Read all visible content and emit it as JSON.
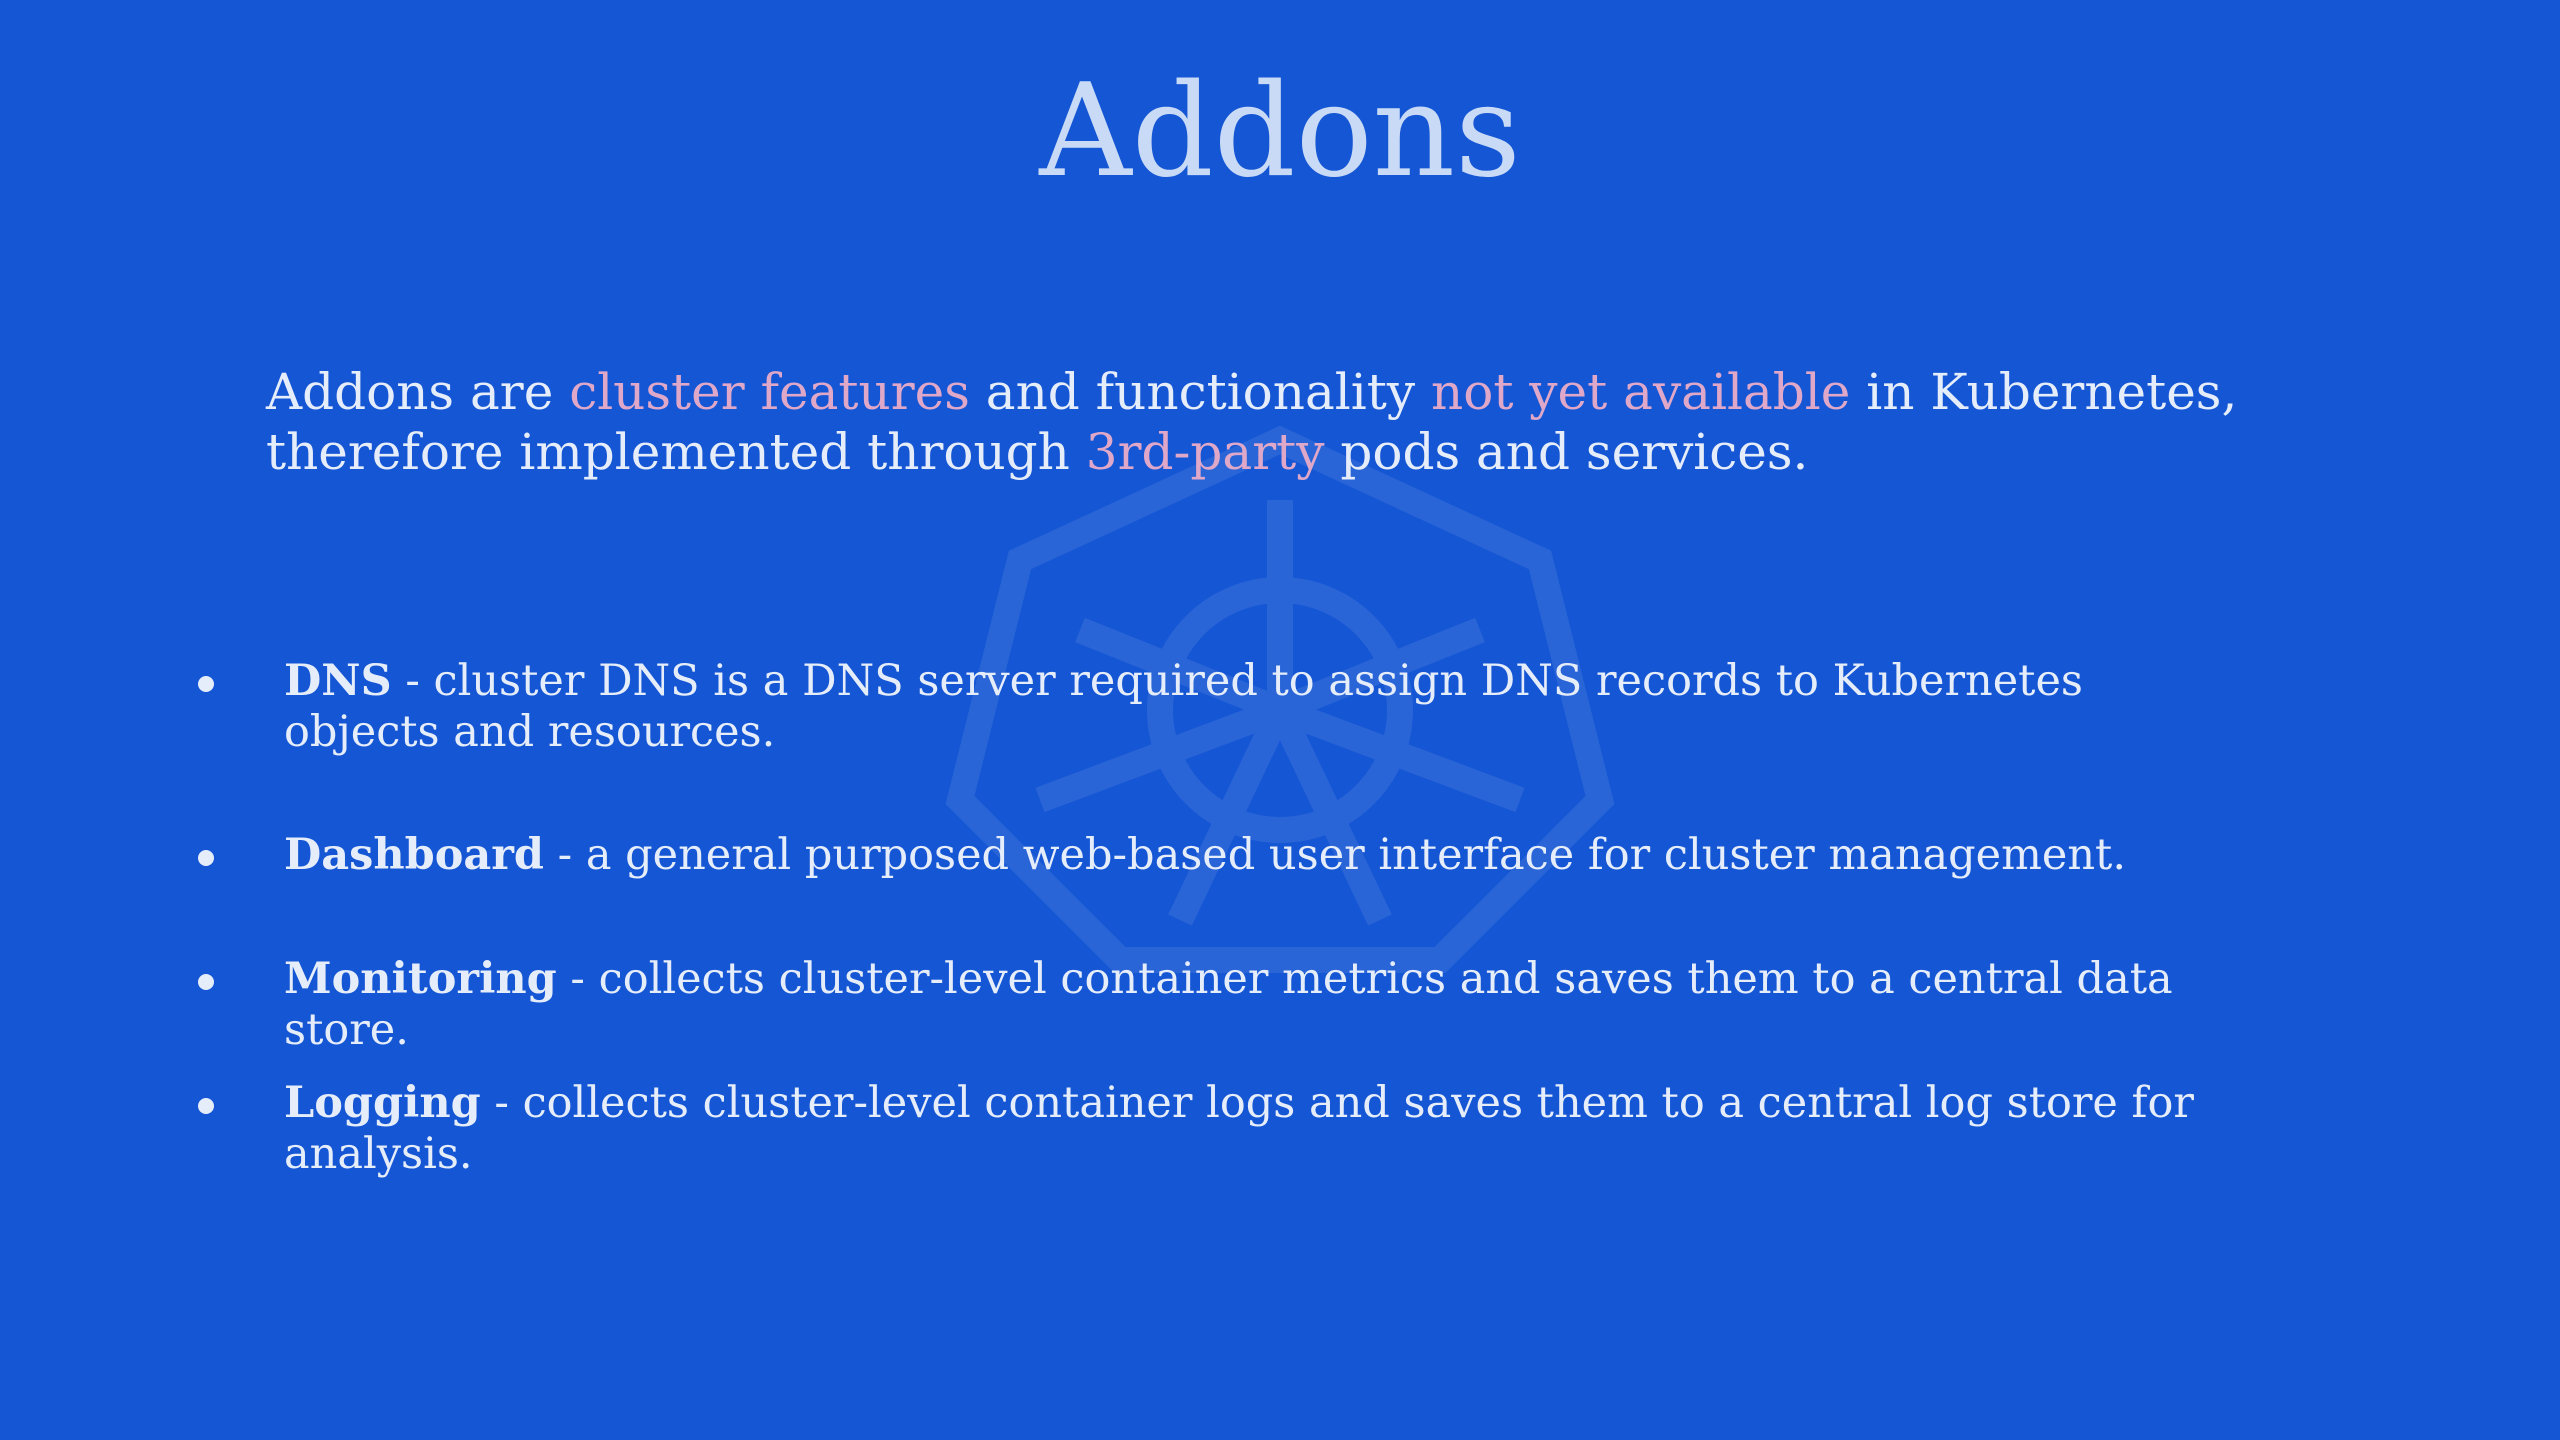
{
  "slide": {
    "title": "Addons",
    "intro": {
      "part1": "Addons are ",
      "hl1": "cluster features",
      "part2": " and functionality ",
      "hl2": "not yet available",
      "part3": " in Kubernetes, therefore implemented through ",
      "hl3": "3rd-party",
      "part4": " pods and services."
    },
    "bullets": [
      {
        "term": "DNS",
        "desc": " - cluster DNS is a DNS server required to assign DNS records to Kubernetes objects and resources."
      },
      {
        "term": "Dashboard",
        "desc": " - a general purposed web-based user interface for cluster management."
      },
      {
        "term": "Monitoring",
        "desc": " - collects cluster-level container metrics and saves them to a central data store."
      },
      {
        "term": "Logging",
        "desc": " - collects cluster-level container logs and saves them to a central log store for analysis."
      }
    ]
  },
  "colors": {
    "background": "#1556d4",
    "title": "#c8daf6",
    "text": "#e6edfa",
    "highlight": "#e0a8c8"
  },
  "icons": {
    "watermark": "kubernetes-helm-wheel-icon"
  }
}
